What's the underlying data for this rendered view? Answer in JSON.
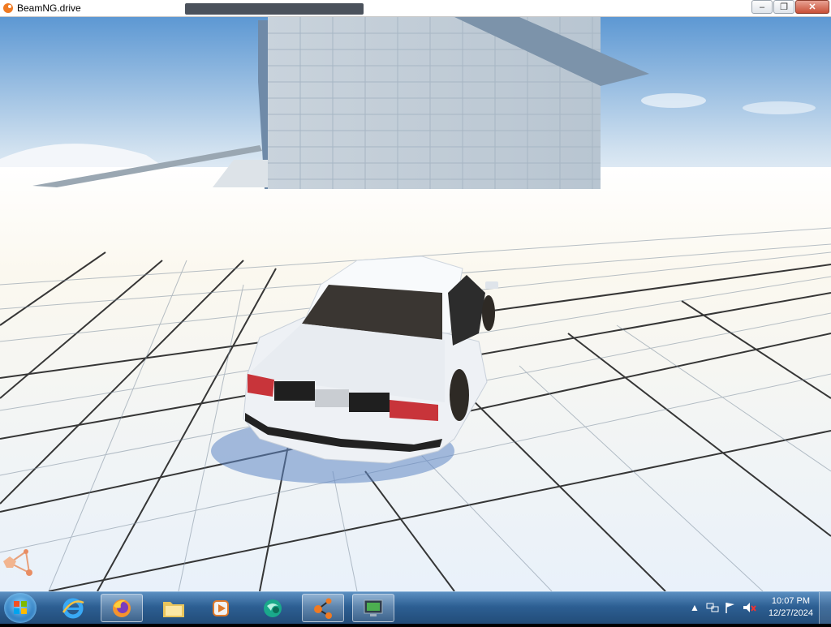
{
  "window": {
    "title": "BeamNG.drive",
    "buttons": {
      "minimize": "‒",
      "maximize": "❐",
      "close": "✕"
    }
  },
  "scene": {
    "sky_top": "#6aa2d8",
    "sky_bottom": "#e9f1f8",
    "ground": "#f4f7fb",
    "grid_line": "#1a1a1a",
    "car_color": "#f2f4f7"
  },
  "taskbar": {
    "items": [
      {
        "name": "internet-explorer",
        "icon": "ie-icon"
      },
      {
        "name": "firefox",
        "icon": "firefox-icon"
      },
      {
        "name": "file-explorer",
        "icon": "folder-icon"
      },
      {
        "name": "media-player",
        "icon": "media-icon"
      },
      {
        "name": "app-green",
        "icon": "green-globe-icon"
      },
      {
        "name": "beamng",
        "icon": "beamng-icon"
      },
      {
        "name": "remote-desktop",
        "icon": "monitor-icon"
      }
    ],
    "time": "10:07 PM",
    "date": "12/27/2024"
  }
}
